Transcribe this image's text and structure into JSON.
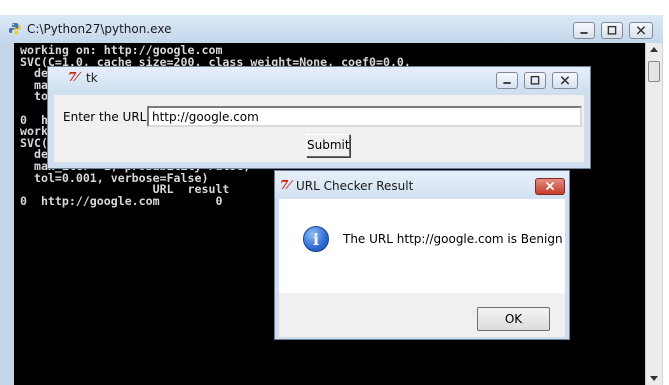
{
  "console_window": {
    "title": "C:\\Python27\\python.exe",
    "icon": "python-icon",
    "lines": [
      "working on: http://google.com",
      "SVC(C=1.0, cache_size=200, class_weight=None, coef0=0.0,",
      "  dec",
      "  max",
      "  tol",
      "",
      "0  ht",
      "worki",
      "SVC(C",
      "  decision_function_shape='ovr',",
      "  max_iter=-1, probability=False,",
      "  tol=0.001, verbose=False)",
      "                   URL  result",
      "0  http://google.com        0"
    ]
  },
  "tk_window": {
    "title": "tk",
    "icon": "tk-feather-icon",
    "url_label": "Enter the URL:",
    "url_value": "http://google.com",
    "submit_label": "Submit"
  },
  "result_dialog": {
    "title": "URL Checker Result",
    "icon": "tk-feather-icon",
    "message": "The URL http://google.com is Benign",
    "info_icon": "info-icon",
    "ok_label": "OK"
  },
  "colors": {
    "titlebar": "#c4d7ec",
    "console_bg": "#000000",
    "console_fg": "#d8d8d8",
    "close_button": "#c43b2b"
  }
}
